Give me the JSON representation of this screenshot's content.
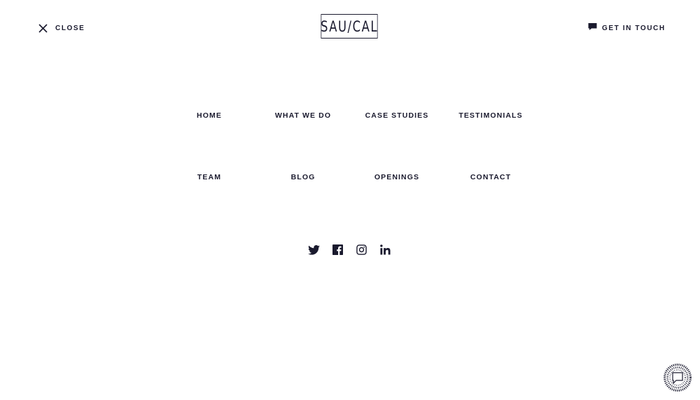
{
  "header": {
    "close_label": "CLOSE",
    "logo_text": "SAU/CAL",
    "get_in_touch_label": "GET IN TOUCH"
  },
  "nav": {
    "items": [
      {
        "label": "HOME"
      },
      {
        "label": "WHAT WE DO"
      },
      {
        "label": "CASE STUDIES"
      },
      {
        "label": "TESTIMONIALS"
      },
      {
        "label": "TEAM"
      },
      {
        "label": "BLOG"
      },
      {
        "label": "OPENINGS"
      },
      {
        "label": "CONTACT"
      }
    ]
  },
  "social": {
    "icons": [
      "twitter-icon",
      "facebook-icon",
      "instagram-icon",
      "linkedin-icon"
    ]
  },
  "chat_widget": {
    "icon": "chat-widget-icon"
  },
  "colors": {
    "text": "#1a1a2e",
    "background": "#ffffff"
  }
}
